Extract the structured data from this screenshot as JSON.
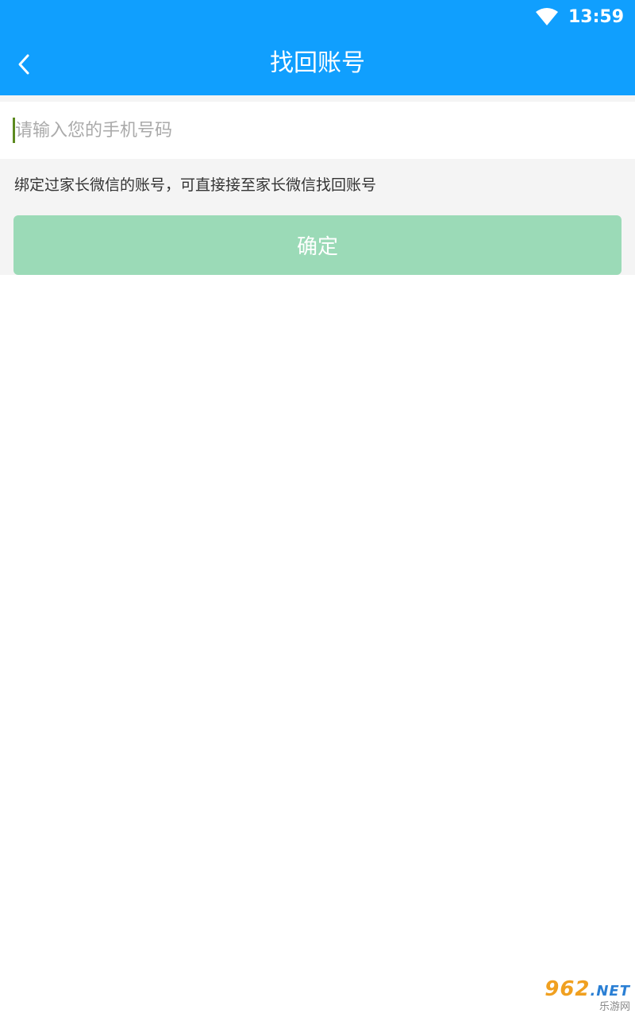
{
  "status_bar": {
    "time": "13:59",
    "wifi_icon": "wifi-icon"
  },
  "header": {
    "title": "找回账号",
    "back_icon": "chevron-left-icon",
    "background": "#109ffe"
  },
  "form": {
    "phone_placeholder": "请输入您的手机号码",
    "phone_value": "",
    "hint": "绑定过家长微信的账号，可直接接至家长微信找回账号",
    "confirm_label": "确定",
    "confirm_color": "#9bdab7"
  },
  "watermark": {
    "logo": "962",
    "logo_suffix": ".NET",
    "sub": "乐游网"
  }
}
